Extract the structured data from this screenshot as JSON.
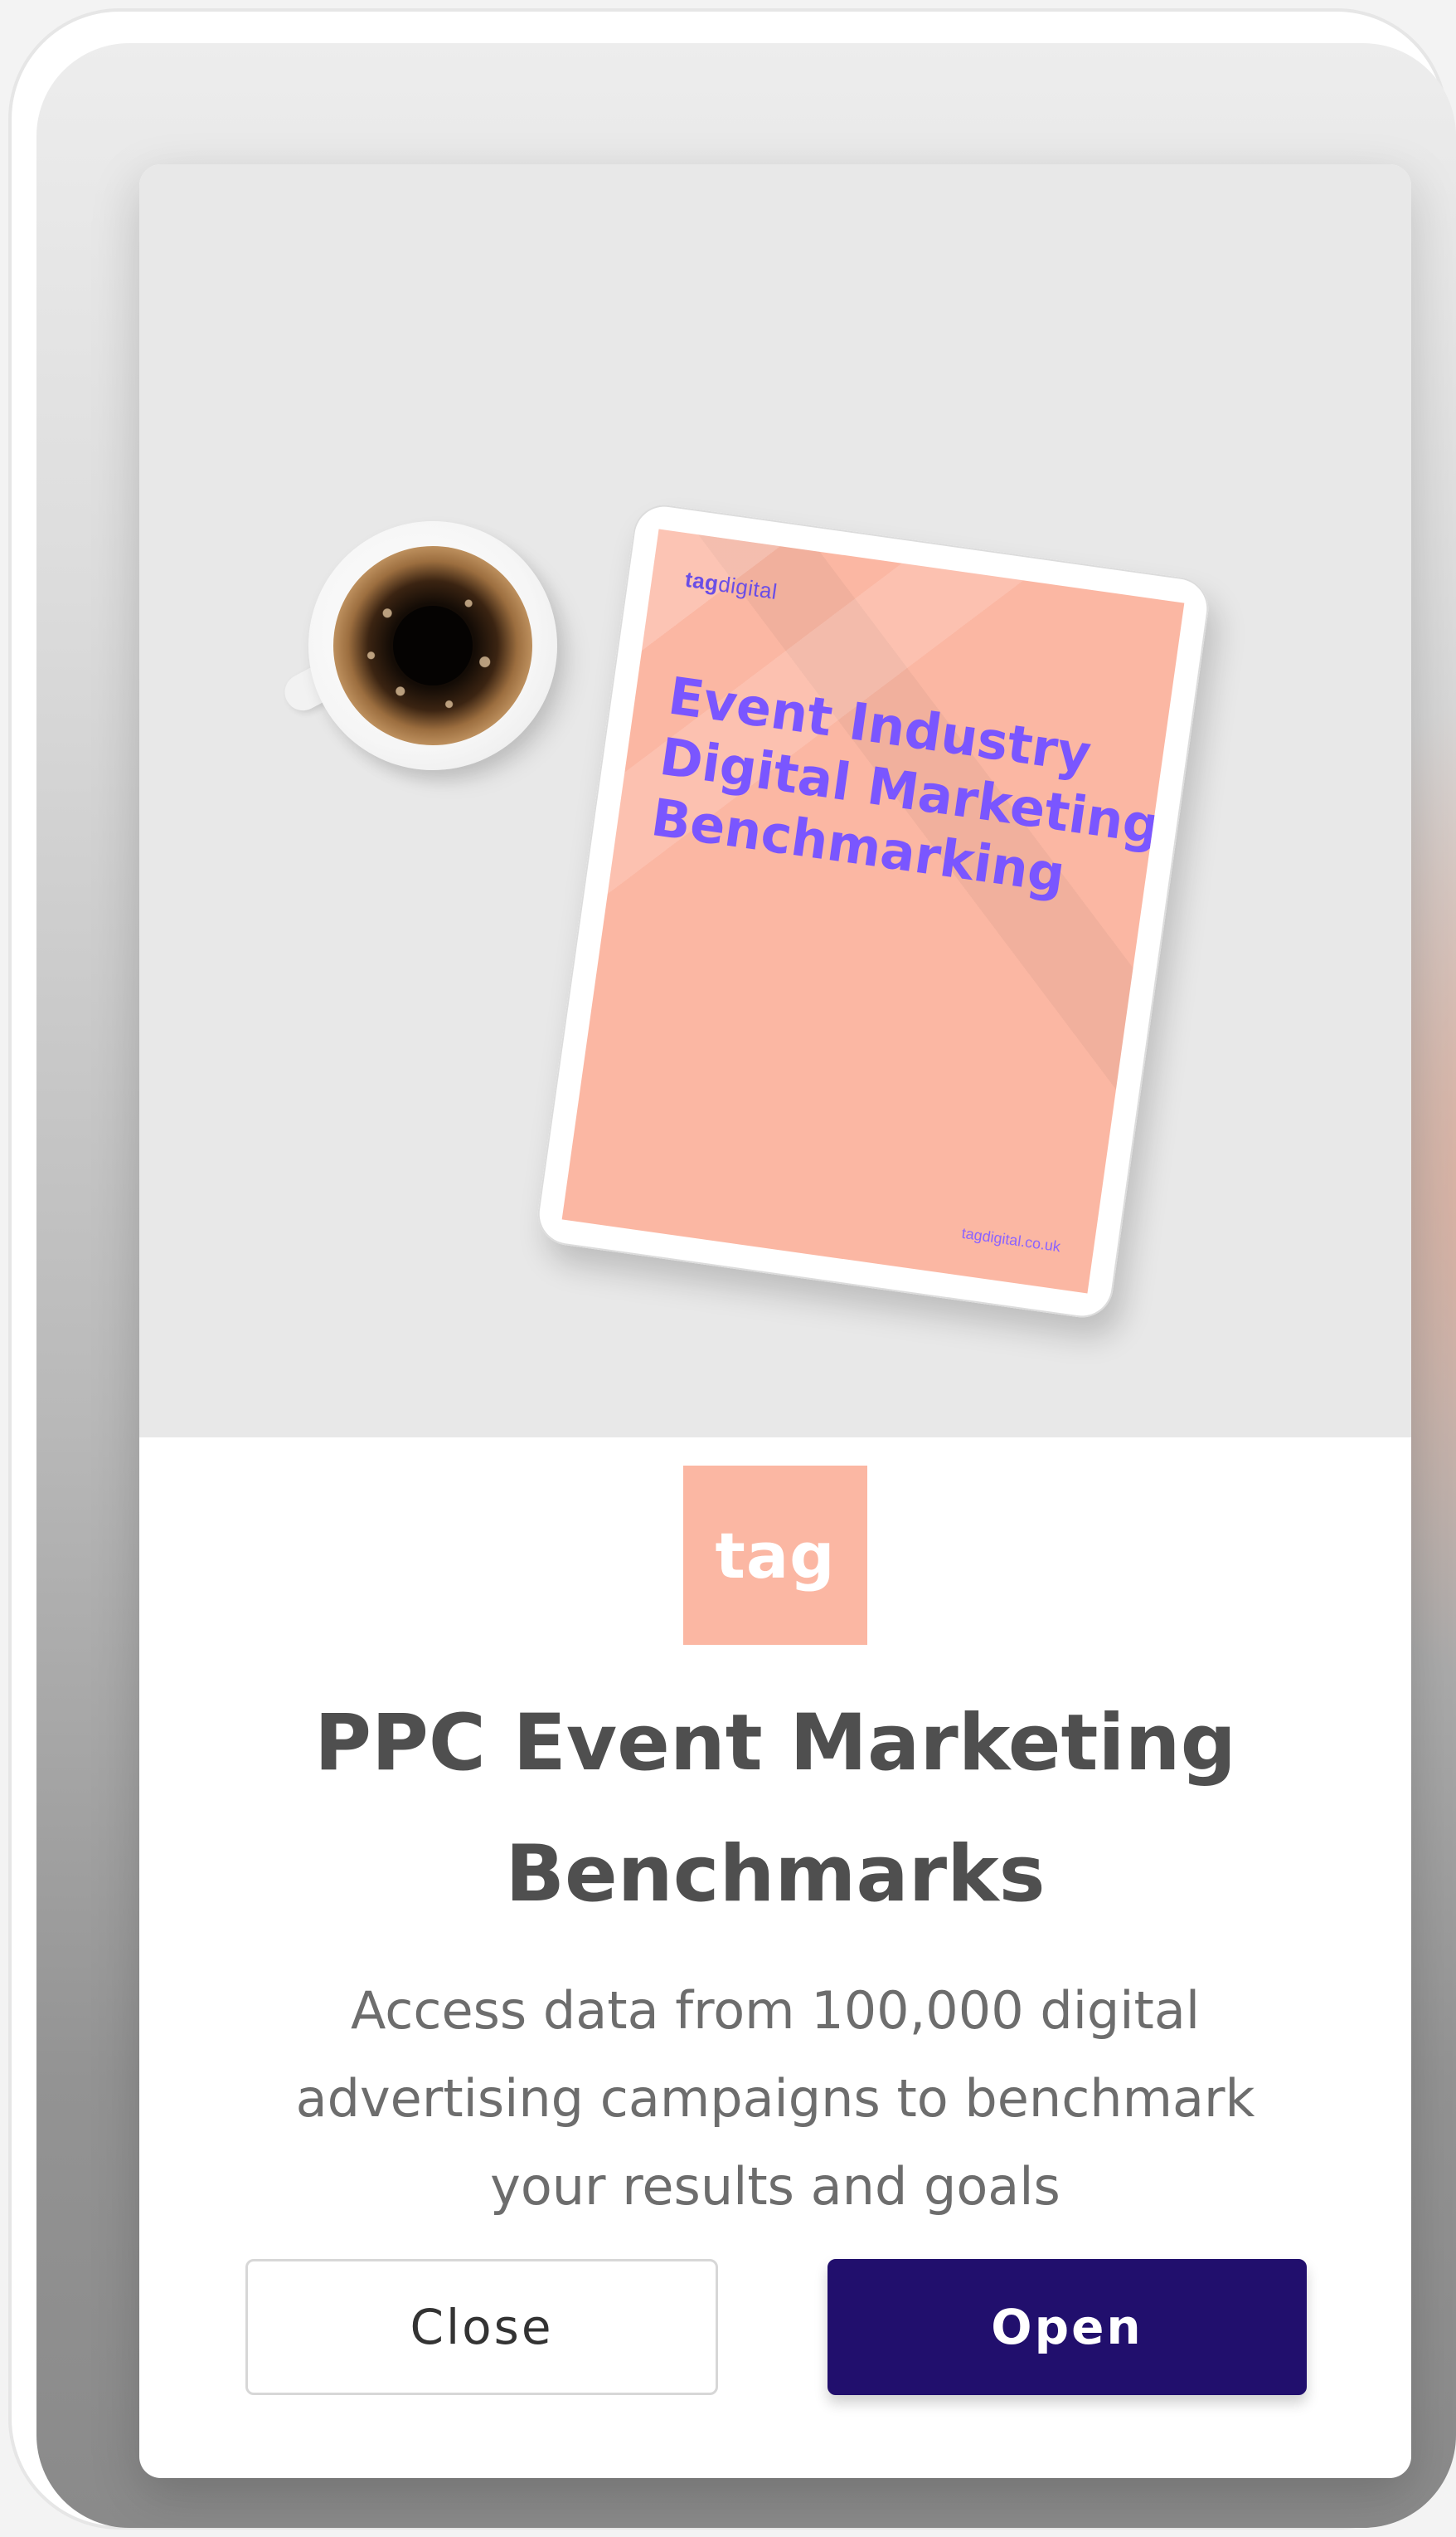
{
  "hero": {
    "tablet": {
      "logo_bold": "tag",
      "logo_light": "digital",
      "title_lines": [
        "Event Industry",
        "Digital Marketing",
        "Benchmarking"
      ],
      "url": "tagdigital.co.uk"
    }
  },
  "brand": {
    "logo_text": "tag",
    "tile_color": "#fbb7a3"
  },
  "content": {
    "title": "PPC Event Marketing Benchmarks",
    "description": "Access data from 100,000 digital advertising campaigns to benchmark your results and goals"
  },
  "actions": {
    "close_label": "Close",
    "open_label": "Open"
  },
  "colors": {
    "primary_button": "#210f6d",
    "title_text": "#4f4f4f",
    "tablet_title": "#7a56ff"
  }
}
